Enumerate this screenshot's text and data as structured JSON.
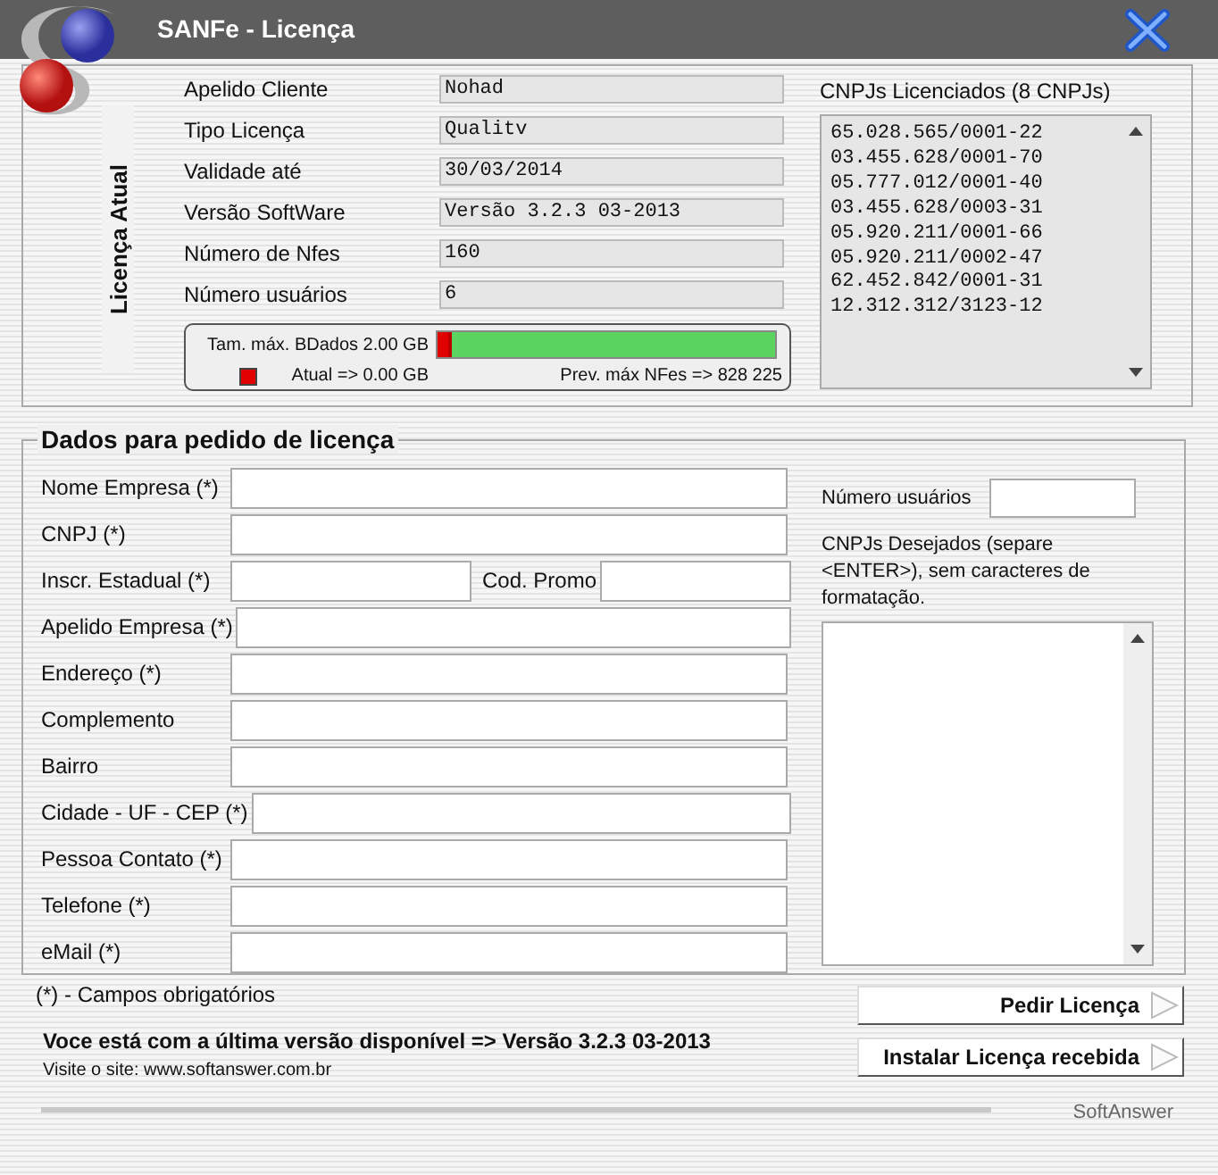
{
  "window": {
    "title": "SANFe - Licença"
  },
  "current_license": {
    "heading": "Licença Atual",
    "fields": [
      {
        "label": "Apelido Cliente",
        "value": "Nohad"
      },
      {
        "label": "Tipo Licença",
        "value": "Qualitv"
      },
      {
        "label": "Validade até",
        "value": "30/03/2014"
      },
      {
        "label": "Versão SoftWare",
        "value": "Versão 3.2.3 03-2013"
      },
      {
        "label": "Número de Nfes",
        "value": "160"
      },
      {
        "label": "Número usuários",
        "value": "6"
      }
    ],
    "storage": {
      "max_label": "Tam. máx. BDados 2.00 GB",
      "level": 0.03,
      "current_label": "Atual => 0.00 GB",
      "forecast_label": "Prev. máx NFes  => 828 225"
    },
    "cnpjs_title": "CNPJs Licenciados  (8 CNPJs)",
    "cnpjs": [
      "65.028.565/0001-22",
      "03.455.628/0001-70",
      "05.777.012/0001-40",
      "03.455.628/0003-31",
      "05.920.211/0001-66",
      "05.920.211/0002-47",
      "62.452.842/0001-31",
      "12.312.312/3123-12"
    ]
  },
  "request": {
    "heading": "Dados para pedido de licença",
    "fields": [
      {
        "kind": "single",
        "label": "Nome Empresa (*)"
      },
      {
        "kind": "single",
        "label": "CNPJ (*)"
      },
      {
        "kind": "pair",
        "label": "Inscr. Estadual (*)",
        "second_label": "Cod. Promo"
      },
      {
        "kind": "single",
        "label": "Apelido Empresa (*)"
      },
      {
        "kind": "single",
        "label": "Endereço (*)"
      },
      {
        "kind": "single",
        "label": "Complemento"
      },
      {
        "kind": "single",
        "label": "Bairro"
      },
      {
        "kind": "single",
        "label": "Cidade - UF - CEP (*)"
      },
      {
        "kind": "single",
        "label": "Pessoa Contato (*)"
      },
      {
        "kind": "single",
        "label": "Telefone (*)"
      },
      {
        "kind": "single",
        "label": "eMail (*)"
      }
    ],
    "users_label": "Número usuários",
    "cnpjs_hint": "CNPJs Desejados (separe <ENTER>), sem caracteres de formatação."
  },
  "footer": {
    "note": "(*) - Campos obrigatórios",
    "version_message": "Voce está com a última versão disponível => Versão 3.2.3 03-2013",
    "site": "Visite o site: www.softanswer.com.br",
    "buttons": [
      "Pedir Licença",
      "Instalar Licença recebida"
    ],
    "brand": "SoftAnswer"
  }
}
